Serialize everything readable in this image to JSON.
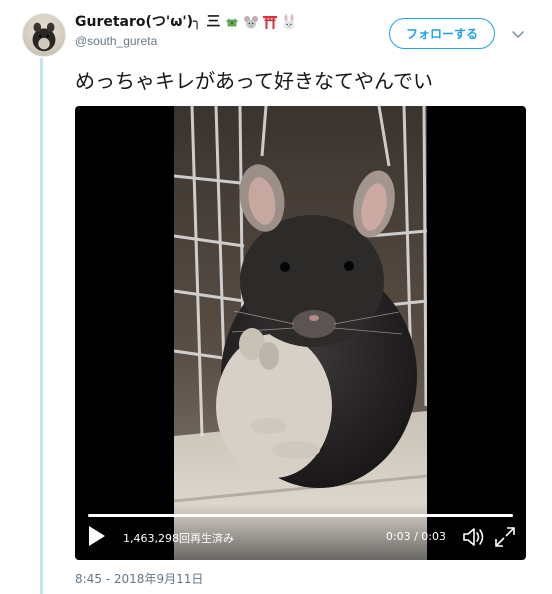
{
  "user": {
    "display_name": "Guretaro(つ'ω')╮ 三",
    "handle": "@south_gureta",
    "emoji_icons": [
      "money-with-wings-icon",
      "mouse-face-icon",
      "torii-gate-icon",
      "rabbit-face-icon"
    ]
  },
  "follow_button": {
    "label": "フォローする"
  },
  "tweet": {
    "text": "めっちゃキレがあって好きなてやんでい",
    "timestamp": "8:45 - 2018年9月11日"
  },
  "video": {
    "view_count": "1,463,298回再生済み",
    "time": "0:03 / 0:03",
    "progress": 1.0,
    "controls": [
      "play-icon",
      "volume-icon",
      "fullscreen-icon"
    ]
  },
  "colors": {
    "accent": "#1da1f2",
    "thread_line": "#c4e4f5",
    "secondary_text": "#657786",
    "primary_text": "#14171a"
  }
}
